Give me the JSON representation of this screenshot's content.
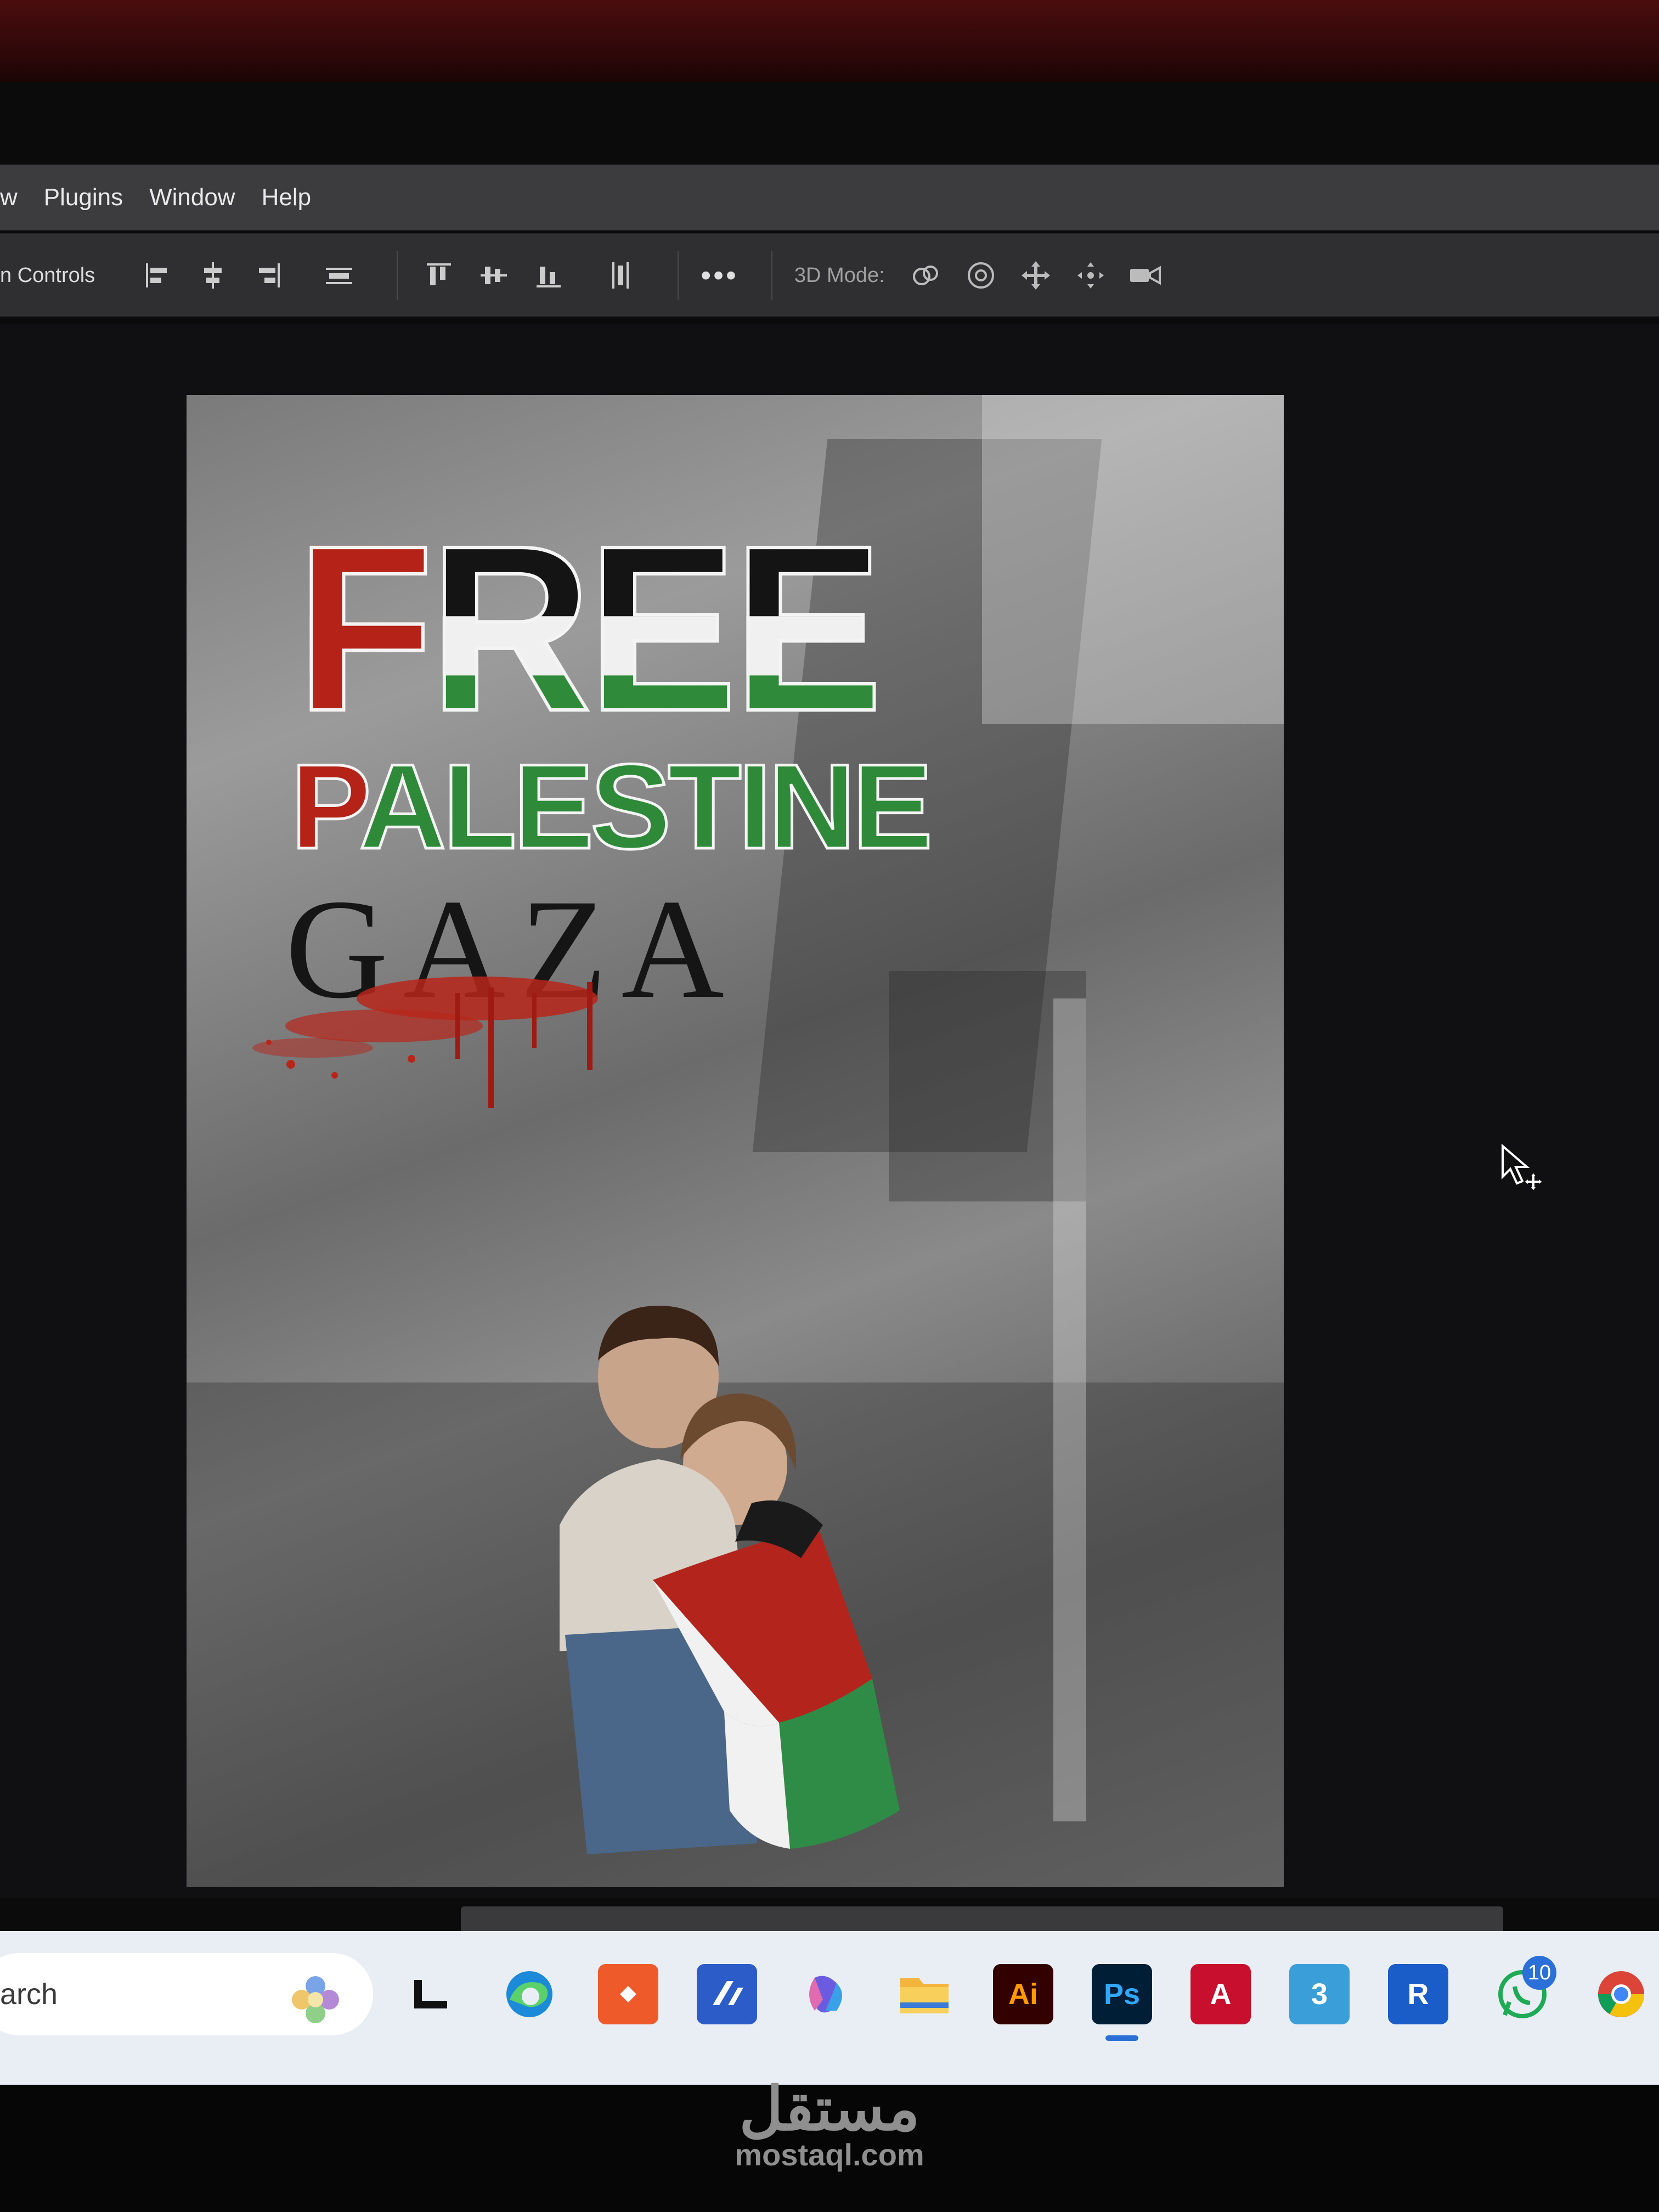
{
  "menu": {
    "items": [
      "w",
      "Plugins",
      "Window",
      "Help"
    ]
  },
  "options_bar": {
    "label": "n Controls",
    "more": "•••",
    "mode_label": "3D Mode:"
  },
  "document": {
    "headline": "FREE",
    "subheadline_first": "P",
    "subheadline_rest": "ALESTINE",
    "place": "GAZA"
  },
  "taskbar": {
    "search_text": "arch",
    "apps": [
      {
        "name": "task-view",
        "label": ""
      },
      {
        "name": "edge",
        "label": ""
      },
      {
        "name": "anydesk",
        "label": ""
      },
      {
        "name": "vscode",
        "label": ""
      },
      {
        "name": "copilot",
        "label": ""
      },
      {
        "name": "file-explorer",
        "label": ""
      },
      {
        "name": "illustrator",
        "label": "Ai"
      },
      {
        "name": "photoshop",
        "label": "Ps"
      },
      {
        "name": "autocad",
        "label": "A"
      },
      {
        "name": "3dsmax",
        "label": "3"
      },
      {
        "name": "revit",
        "label": "R"
      },
      {
        "name": "whatsapp",
        "label": ""
      },
      {
        "name": "chrome",
        "label": ""
      }
    ],
    "whatsapp_badge": "10",
    "colors": {
      "photoshop": "#001e36",
      "illustrator": "#330000",
      "autocad": "#c8102e"
    }
  },
  "watermark": {
    "arabic": "مستقل",
    "url": "mostaql.com"
  }
}
